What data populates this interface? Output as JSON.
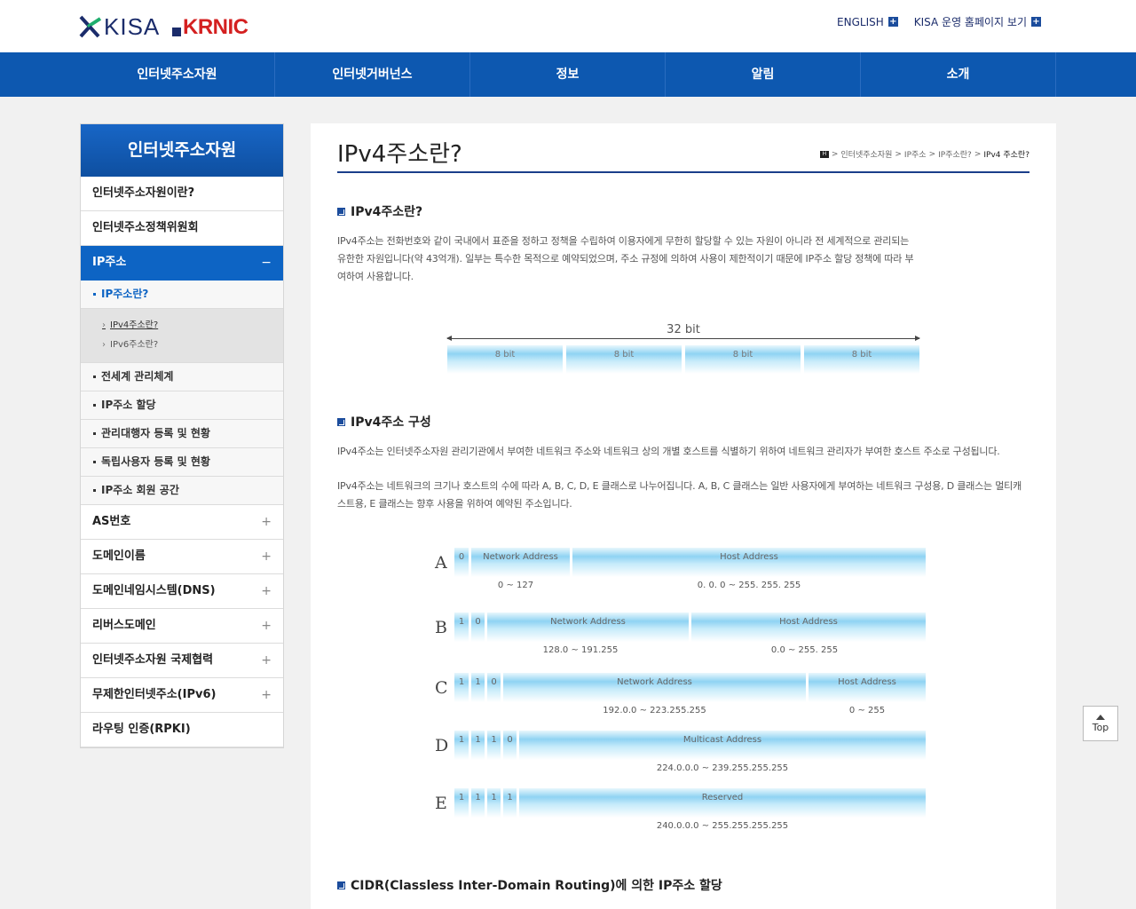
{
  "header": {
    "logo_kisa": "KISA",
    "logo_krnic": "KRNIC",
    "links": [
      "ENGLISH",
      "KISA 운영 홈페이지 보기"
    ]
  },
  "gnb": [
    "인터넷주소자원",
    "인터넷거버넌스",
    "정보",
    "알림",
    "소개"
  ],
  "sidebar": {
    "title": "인터넷주소자원",
    "items": [
      {
        "label": "인터넷주소자원이란?",
        "sign": ""
      },
      {
        "label": "인터넷주소정책위원회",
        "sign": ""
      },
      {
        "label": "IP주소",
        "sign": "−"
      },
      {
        "label": "AS번호",
        "sign": "+"
      },
      {
        "label": "도메인이름",
        "sign": "+"
      },
      {
        "label": "도메인네임시스템(DNS)",
        "sign": "+"
      },
      {
        "label": "리버스도메인",
        "sign": "+"
      },
      {
        "label": "인터넷주소자원 국제협력",
        "sign": "+"
      },
      {
        "label": "무제한인터넷주소(IPv6)",
        "sign": "+"
      },
      {
        "label": "라우팅 인증(RPKI)",
        "sign": ""
      }
    ],
    "sub_items": [
      "IP주소란?",
      "전세계 관리체계",
      "IP주소 할당",
      "관리대행자 등록 및 현황",
      "독립사용자 등록 및 현황",
      "IP주소 회원 공간"
    ],
    "sub_sub_items": [
      "IPv4주소란?",
      "IPv6주소란?"
    ]
  },
  "content": {
    "title": "IPv4주소란?",
    "breadcrumb": [
      "인터넷주소자원",
      "IP주소",
      "IP주소란?",
      "IPv4 주소란?"
    ],
    "breadcrumb_home": "H",
    "sec1_title": "IPv4주소란?",
    "sec1_body": "IPv4주소는 전화번호와 같이 국내에서 표준을 정하고 정책을 수립하여 이용자에게 무한히 할당할 수 있는 자원이 아니라 전 세계적으로 관리되는 유한한 자원입니다(약 43억개). 일부는 특수한 목적으로 예약되었으며, 주소 규정에 의하여 사용이 제한적이기 때문에 IP주소 할당 정책에 따라 부여하여 사용합니다.",
    "bits_label": "32 bit",
    "bits_cells": [
      "8 bit",
      "8 bit",
      "8 bit",
      "8 bit"
    ],
    "sec2_title": "IPv4주소 구성",
    "sec2_body1": "IPv4주소는 인터넷주소자원 관리기관에서 부여한 네트워크 주소와 네트워크 상의 개별 호스트를 식별하기 위하여 네트워크 관리자가 부여한 호스트 주소로 구성됩니다.",
    "sec2_body2": "IPv4주소는 네트워크의 크기나 호스트의 수에 따라 A, B, C, D, E 클래스로 나누어집니다. A, B, C 클래스는 일반 사용자에게 부여하는 네트워크 구성용, D 클래스는 멀티캐스트용, E 클래스는 향후 사용을 위하여 예약된 주소입니다.",
    "classes": [
      {
        "letter": "A",
        "bits": [
          "0"
        ],
        "net": "Network Address",
        "host": "Host Address",
        "net_range": "0 ~ 127",
        "host_range": "0. 0. 0 ~ 255. 255. 255"
      },
      {
        "letter": "B",
        "bits": [
          "1",
          "0"
        ],
        "net": "Network Address",
        "host": "Host Address",
        "net_range": "128.0 ~ 191.255",
        "host_range": "0.0 ~ 255. 255"
      },
      {
        "letter": "C",
        "bits": [
          "1",
          "1",
          "0"
        ],
        "net": "Network Address",
        "host": "Host Address",
        "net_range": "192.0.0 ~ 223.255.255",
        "host_range": "0 ~ 255"
      },
      {
        "letter": "D",
        "bits": [
          "1",
          "1",
          "1",
          "0"
        ],
        "net": "Multicast Address",
        "net_range": "224.0.0.0 ~ 239.255.255.255"
      },
      {
        "letter": "E",
        "bits": [
          "1",
          "1",
          "1",
          "1"
        ],
        "net": "Reserved",
        "net_range": "240.0.0.0 ~ 255.255.255.255"
      }
    ],
    "sec3_title": "CIDR(Classless Inter-Domain Routing)에 의한 IP주소 할당"
  },
  "top_button": "Top"
}
